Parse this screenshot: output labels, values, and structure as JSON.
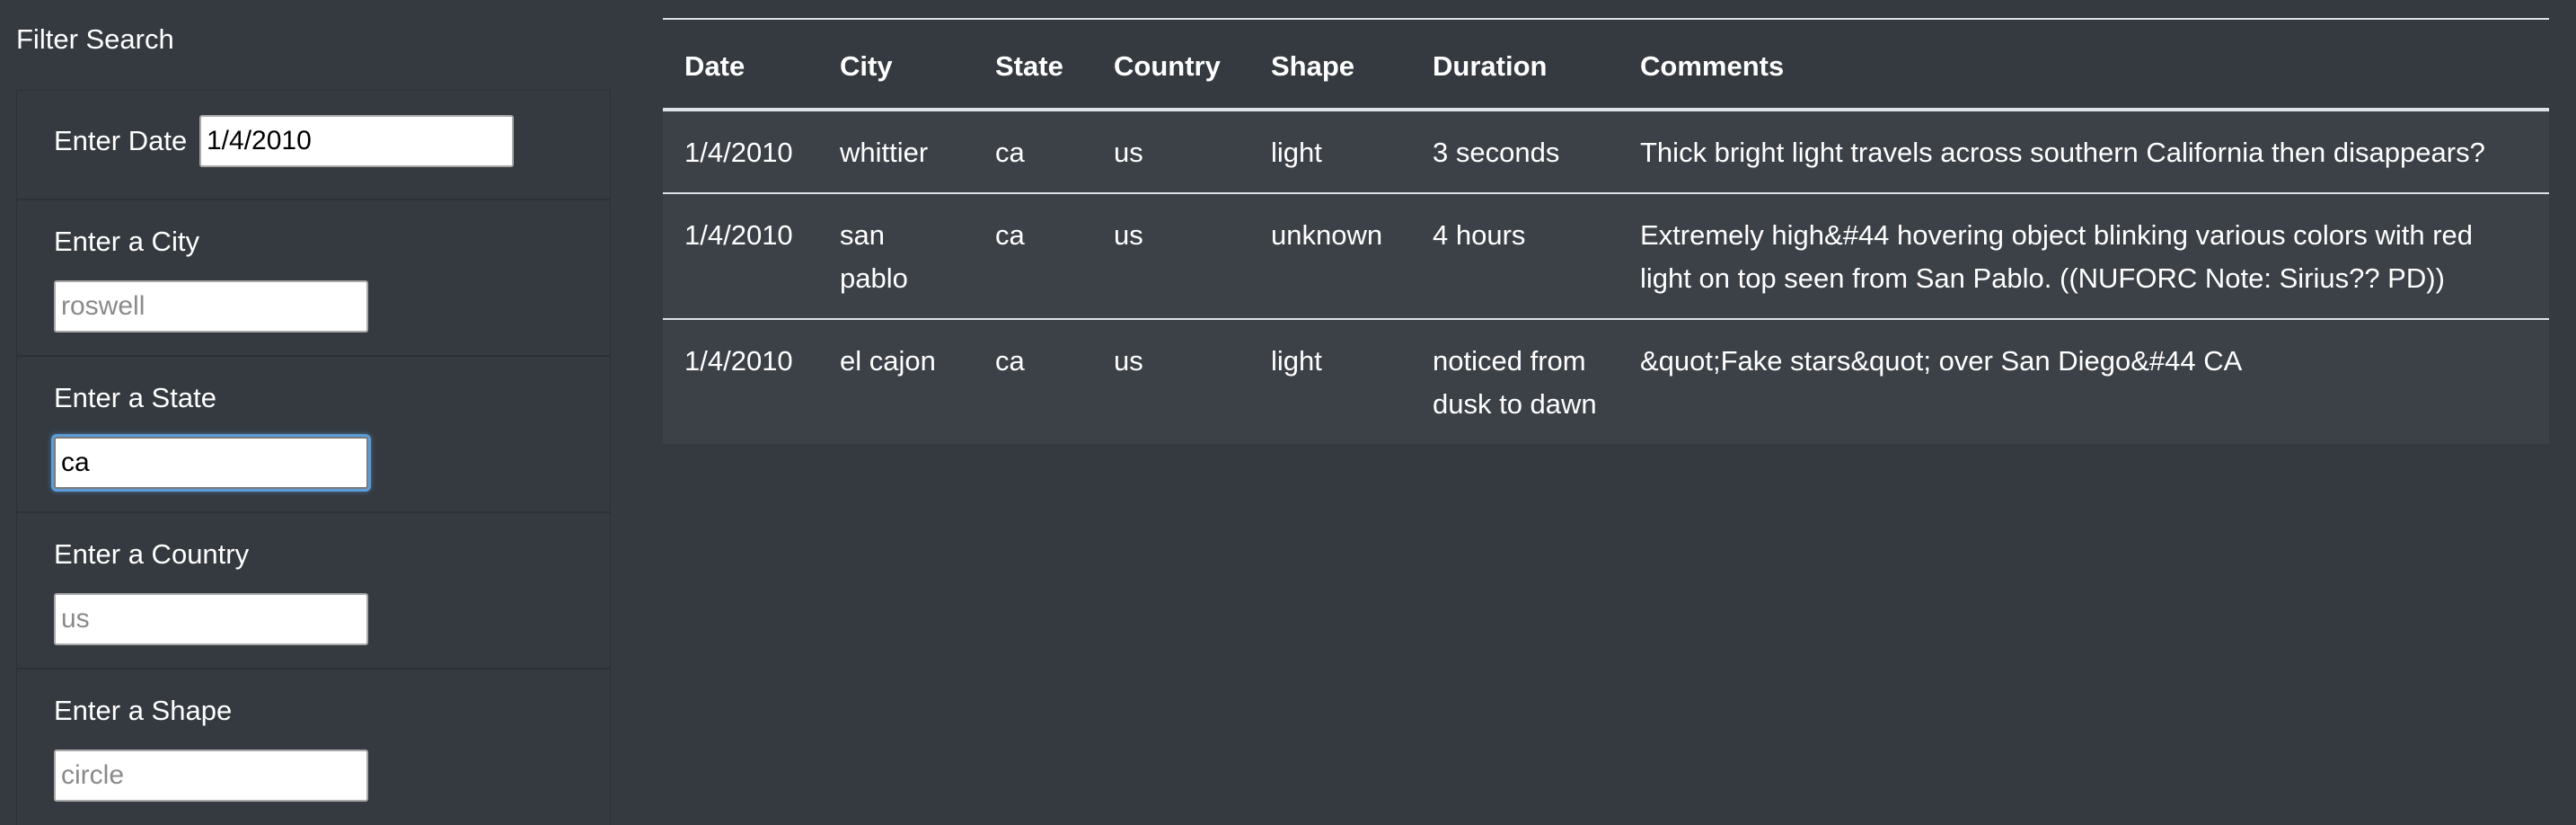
{
  "sidebar": {
    "title": "Filter Search",
    "filters": [
      {
        "label": "Enter Date",
        "value": "1/4/2010",
        "placeholder": ""
      },
      {
        "label": "Enter a City",
        "value": "",
        "placeholder": "roswell"
      },
      {
        "label": "Enter a State",
        "value": "ca",
        "placeholder": ""
      },
      {
        "label": "Enter a Country",
        "value": "",
        "placeholder": "us"
      },
      {
        "label": "Enter a Shape",
        "value": "",
        "placeholder": "circle"
      }
    ]
  },
  "table": {
    "headers": [
      "Date",
      "City",
      "State",
      "Country",
      "Shape",
      "Duration",
      "Comments"
    ],
    "rows": [
      {
        "date": "1/4/2010",
        "city": "whittier",
        "state": "ca",
        "country": "us",
        "shape": "light",
        "duration": "3 seconds",
        "comments": "Thick bright light travels across southern California then disappears?"
      },
      {
        "date": "1/4/2010",
        "city": "san pablo",
        "state": "ca",
        "country": "us",
        "shape": "unknown",
        "duration": "4 hours",
        "comments": "Extremely high&#44 hovering object blinking various colors with red light on top seen from San Pablo. ((NUFORC Note: Sirius?? PD))"
      },
      {
        "date": "1/4/2010",
        "city": "el cajon",
        "state": "ca",
        "country": "us",
        "shape": "light",
        "duration": "noticed from dusk to dawn",
        "comments": "&quot;Fake stars&quot; over San Diego&#44 CA"
      }
    ]
  },
  "colors": {
    "background": "#343a40",
    "row_background": "#3c4148",
    "border": "#dee2e6",
    "focus_ring": "#5b9dd9"
  }
}
